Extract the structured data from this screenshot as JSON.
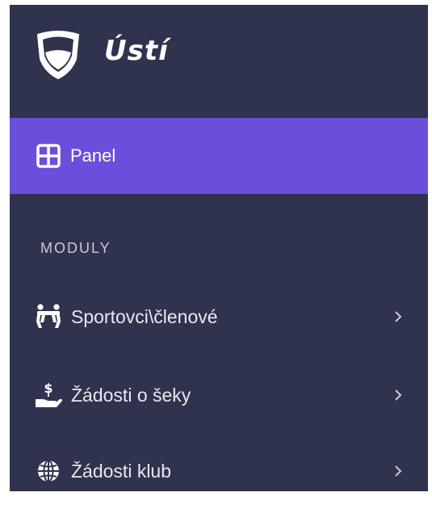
{
  "brand": {
    "name": "Ústí",
    "logo_icon": "shield-logo-icon"
  },
  "nav": {
    "panel": {
      "label": "Panel",
      "icon": "grid-icon",
      "active": true
    }
  },
  "section": {
    "title": "MODULY"
  },
  "menu": {
    "items": [
      {
        "label": "Sportovci\\členové",
        "icon": "people-icon"
      },
      {
        "label": "Žádosti o šeky",
        "icon": "hand-dollar-icon"
      },
      {
        "label": "Žádosti klub",
        "icon": "globe-icon"
      }
    ]
  },
  "colors": {
    "sidebar_bg": "#30334e",
    "active_bg": "#6a4fdc",
    "text": "#e7e8f0",
    "muted": "#c9cad8"
  }
}
